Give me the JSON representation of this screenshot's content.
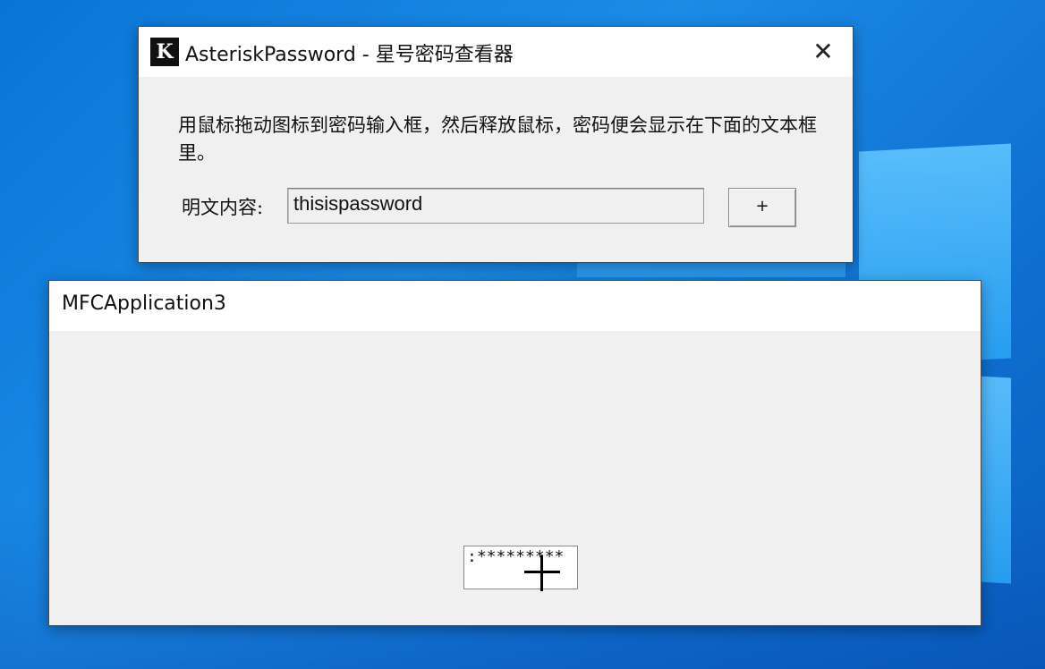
{
  "asterisk_window": {
    "icon_letter": "K",
    "title": "AsteriskPassword - 星号密码查看器",
    "close_glyph": "✕",
    "description": "用鼠标拖动图标到密码输入框，然后释放鼠标，密码便会显示在下面的文本框里。",
    "plain_label": "明文内容:",
    "plain_value": "thisispassword",
    "target_button_label": "+"
  },
  "mfc_window": {
    "title": "MFCApplication3",
    "password_masked": ":*********"
  }
}
